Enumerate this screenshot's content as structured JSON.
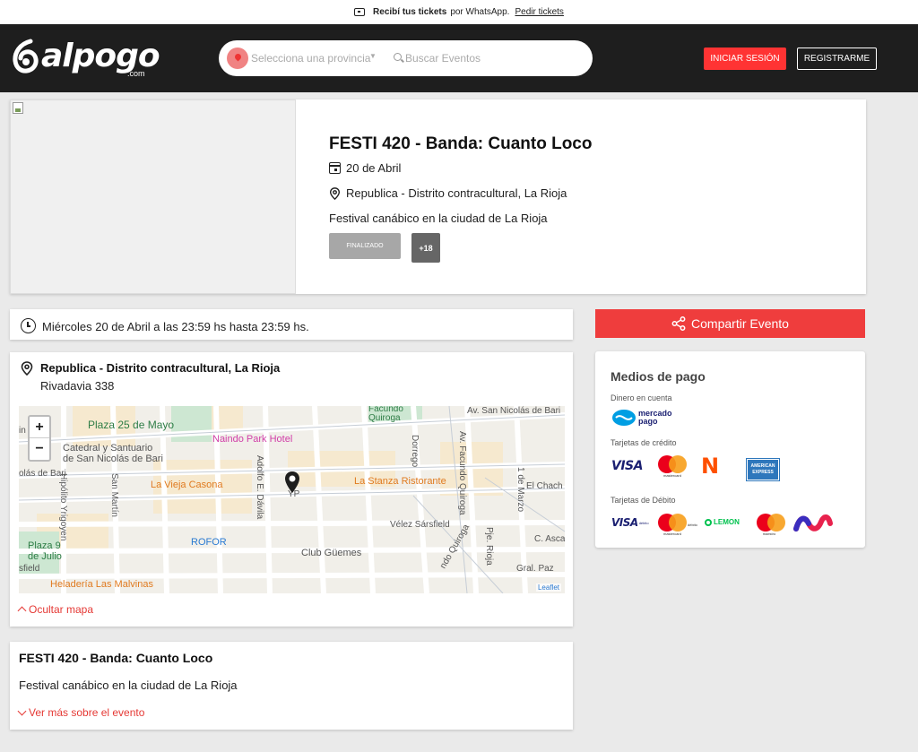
{
  "promo": {
    "bold": "Recibí tus tickets",
    "text": "por WhatsApp.",
    "link": "Pedir tickets"
  },
  "header": {
    "logo_word": "alpogo",
    "logo_suffix": ".com",
    "province_placeholder": "Selecciona una provincia",
    "search_placeholder": "Buscar Eventos",
    "login_label": "INICIAR SESIÓN",
    "register_label": "REGISTRARME"
  },
  "event": {
    "title": "FESTI 420 - Banda: Cuanto Loco",
    "date": "20 de Abril",
    "venue_line": "Republica - Distrito contracultural, La Rioja",
    "summary": "Festival canábico en la ciudad de La Rioja",
    "status_badge": "FINALIZADO",
    "age_badge": "+18"
  },
  "schedule": {
    "text": "Miércoles 20 de Abril a las 23:59 hs hasta 23:59 hs."
  },
  "location": {
    "name": "Republica - Distrito contracultural, La Rioja",
    "address": "Rivadavia 338",
    "hide_map": "Ocultar mapa",
    "map": {
      "zoom_in": "+",
      "zoom_out": "−",
      "attribution": "Leaflet",
      "labels": {
        "plaza25": "Plaza 25 de Mayo",
        "catedral1": "Catedral y Santuario",
        "catedral2": "de San Nicolás de Bari",
        "naindo": "Naindo Park Hotel",
        "vieja": "La Vieja Casona",
        "stanza": "La Stanza Ristorante",
        "rofor": "ROFOR",
        "guemes": "Club Güemes",
        "malvinas": "Heladería Las Malvinas",
        "plaza9a": "Plaza 9",
        "plaza9b": "de Julio",
        "facundo1": "Facundo",
        "facundo2": "Quiroga",
        "snb": "Av. San Nicolás de Bari",
        "snb_left": "olás de Bari",
        "hipolito": "Hipólito Yrigoyen",
        "sanmartin": "San Martín",
        "adolfo": "Adolfo E. Dávila",
        "dorrego": "Dorrego",
        "avfacundo": "Av. Facundo Quiroga",
        "marzo": "1 de Marzo",
        "chacho": "El Chach",
        "velez": "Vélez Sársfield",
        "pje": "Pje. Rioja",
        "ndo": "ndo Quiroga",
        "cacsa": "C. Asca",
        "grpaz": "Gral. Paz",
        "sfield": "sfield",
        "in": "in",
        "yp": "YP"
      }
    }
  },
  "about": {
    "title": "FESTI 420 - Banda: Cuanto Loco",
    "description": "Festival canábico en la ciudad de La Rioja",
    "more": "Ver más sobre el evento"
  },
  "share": {
    "label": "Compartir Evento"
  },
  "payments": {
    "title": "Medios de pago",
    "debit_account": "Dinero en cuenta",
    "credit": "Tarjetas de crédito",
    "debit": "Tarjetas de Débito",
    "mp_line1": "mercado",
    "mp_line2": "pago",
    "visa": "VISA",
    "visa_debit": "VISA",
    "debito": "débito",
    "mastercard": "mastercard",
    "naranja": "N",
    "amex1": "AMERICAN",
    "amex2": "EXPRESS",
    "lemon": "LEMON",
    "maestro": "maestro"
  },
  "colors": {
    "accent": "#ef3d3d",
    "header_bg": "#1e1e1e",
    "link": "#e53935"
  }
}
